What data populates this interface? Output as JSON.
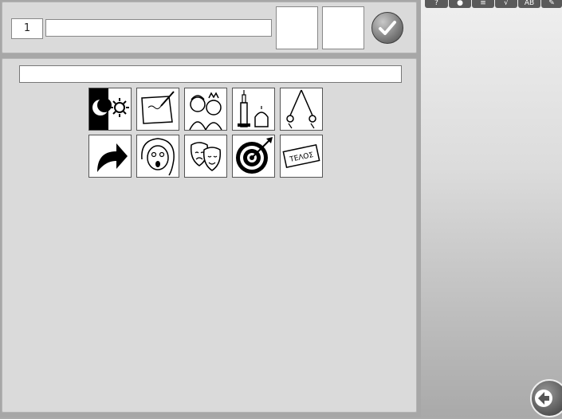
{
  "question": {
    "number": "1",
    "answer_text": ""
  },
  "toolbar": {
    "help_icon": "?",
    "ab_label": "AB"
  },
  "cards": [
    {
      "name": "card-night-day",
      "icon": "moon-sun-icon"
    },
    {
      "name": "card-writing",
      "icon": "pencil-paper-icon"
    },
    {
      "name": "card-people",
      "icon": "people-icon"
    },
    {
      "name": "card-buildings",
      "icon": "buildings-icon"
    },
    {
      "name": "card-swing",
      "icon": "swing-icon"
    },
    {
      "name": "card-arrow",
      "icon": "curved-arrow-icon"
    },
    {
      "name": "card-surprised-girl",
      "icon": "girl-face-icon"
    },
    {
      "name": "card-theater-masks",
      "icon": "masks-icon"
    },
    {
      "name": "card-target",
      "icon": "target-icon"
    },
    {
      "name": "card-end",
      "icon": "sign-icon",
      "label": "ΤΕΛΟΣ"
    }
  ],
  "colors": {
    "panel": "#dadada",
    "background": "#a7a7a7",
    "sidebar_top": "#efefef"
  }
}
